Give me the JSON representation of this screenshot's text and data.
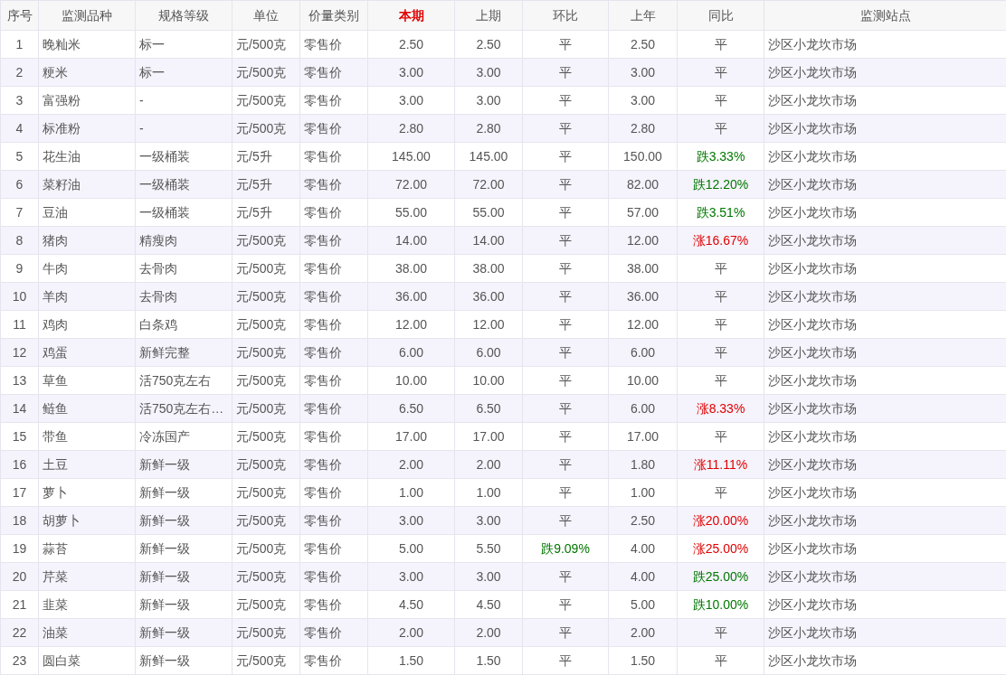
{
  "table": {
    "columns": [
      {
        "label": "序号",
        "highlight": false
      },
      {
        "label": "监测品种",
        "highlight": false
      },
      {
        "label": "规格等级",
        "highlight": false
      },
      {
        "label": "单位",
        "highlight": false
      },
      {
        "label": "价量类别",
        "highlight": false
      },
      {
        "label": "本期",
        "highlight": true
      },
      {
        "label": "上期",
        "highlight": false
      },
      {
        "label": "环比",
        "highlight": false
      },
      {
        "label": "上年",
        "highlight": false
      },
      {
        "label": "同比",
        "highlight": false
      },
      {
        "label": "监测站点",
        "highlight": false
      }
    ],
    "rows": [
      {
        "no": "1",
        "item": "晚籼米",
        "grade": "标一",
        "unit": "元/500克",
        "price_type": "零售价",
        "current": "2.50",
        "previous": "2.50",
        "mom": {
          "text": "平",
          "kind": "flat"
        },
        "last_year": "2.50",
        "yoy": {
          "text": "平",
          "kind": "flat"
        },
        "station": "沙区小龙坎市场"
      },
      {
        "no": "2",
        "item": "粳米",
        "grade": "标一",
        "unit": "元/500克",
        "price_type": "零售价",
        "current": "3.00",
        "previous": "3.00",
        "mom": {
          "text": "平",
          "kind": "flat"
        },
        "last_year": "3.00",
        "yoy": {
          "text": "平",
          "kind": "flat"
        },
        "station": "沙区小龙坎市场"
      },
      {
        "no": "3",
        "item": "富强粉",
        "grade": "-",
        "unit": "元/500克",
        "price_type": "零售价",
        "current": "3.00",
        "previous": "3.00",
        "mom": {
          "text": "平",
          "kind": "flat"
        },
        "last_year": "3.00",
        "yoy": {
          "text": "平",
          "kind": "flat"
        },
        "station": "沙区小龙坎市场"
      },
      {
        "no": "4",
        "item": "标准粉",
        "grade": "-",
        "unit": "元/500克",
        "price_type": "零售价",
        "current": "2.80",
        "previous": "2.80",
        "mom": {
          "text": "平",
          "kind": "flat"
        },
        "last_year": "2.80",
        "yoy": {
          "text": "平",
          "kind": "flat"
        },
        "station": "沙区小龙坎市场"
      },
      {
        "no": "5",
        "item": "花生油",
        "grade": "一级桶装",
        "unit": "元/5升",
        "price_type": "零售价",
        "current": "145.00",
        "previous": "145.00",
        "mom": {
          "text": "平",
          "kind": "flat"
        },
        "last_year": "150.00",
        "yoy": {
          "text": "跌3.33%",
          "kind": "down"
        },
        "station": "沙区小龙坎市场"
      },
      {
        "no": "6",
        "item": "菜籽油",
        "grade": "一级桶装",
        "unit": "元/5升",
        "price_type": "零售价",
        "current": "72.00",
        "previous": "72.00",
        "mom": {
          "text": "平",
          "kind": "flat"
        },
        "last_year": "82.00",
        "yoy": {
          "text": "跌12.20%",
          "kind": "down"
        },
        "station": "沙区小龙坎市场"
      },
      {
        "no": "7",
        "item": "豆油",
        "grade": "一级桶装",
        "unit": "元/5升",
        "price_type": "零售价",
        "current": "55.00",
        "previous": "55.00",
        "mom": {
          "text": "平",
          "kind": "flat"
        },
        "last_year": "57.00",
        "yoy": {
          "text": "跌3.51%",
          "kind": "down"
        },
        "station": "沙区小龙坎市场"
      },
      {
        "no": "8",
        "item": "猪肉",
        "grade": "精瘦肉",
        "unit": "元/500克",
        "price_type": "零售价",
        "current": "14.00",
        "previous": "14.00",
        "mom": {
          "text": "平",
          "kind": "flat"
        },
        "last_year": "12.00",
        "yoy": {
          "text": "涨16.67%",
          "kind": "up"
        },
        "station": "沙区小龙坎市场"
      },
      {
        "no": "9",
        "item": "牛肉",
        "grade": "去骨肉",
        "unit": "元/500克",
        "price_type": "零售价",
        "current": "38.00",
        "previous": "38.00",
        "mom": {
          "text": "平",
          "kind": "flat"
        },
        "last_year": "38.00",
        "yoy": {
          "text": "平",
          "kind": "flat"
        },
        "station": "沙区小龙坎市场"
      },
      {
        "no": "10",
        "item": "羊肉",
        "grade": "去骨肉",
        "unit": "元/500克",
        "price_type": "零售价",
        "current": "36.00",
        "previous": "36.00",
        "mom": {
          "text": "平",
          "kind": "flat"
        },
        "last_year": "36.00",
        "yoy": {
          "text": "平",
          "kind": "flat"
        },
        "station": "沙区小龙坎市场"
      },
      {
        "no": "11",
        "item": "鸡肉",
        "grade": "白条鸡",
        "unit": "元/500克",
        "price_type": "零售价",
        "current": "12.00",
        "previous": "12.00",
        "mom": {
          "text": "平",
          "kind": "flat"
        },
        "last_year": "12.00",
        "yoy": {
          "text": "平",
          "kind": "flat"
        },
        "station": "沙区小龙坎市场"
      },
      {
        "no": "12",
        "item": "鸡蛋",
        "grade": "新鲜完整",
        "unit": "元/500克",
        "price_type": "零售价",
        "current": "6.00",
        "previous": "6.00",
        "mom": {
          "text": "平",
          "kind": "flat"
        },
        "last_year": "6.00",
        "yoy": {
          "text": "平",
          "kind": "flat"
        },
        "station": "沙区小龙坎市场"
      },
      {
        "no": "13",
        "item": "草鱼",
        "grade": "活750克左右",
        "unit": "元/500克",
        "price_type": "零售价",
        "current": "10.00",
        "previous": "10.00",
        "mom": {
          "text": "平",
          "kind": "flat"
        },
        "last_year": "10.00",
        "yoy": {
          "text": "平",
          "kind": "flat"
        },
        "station": "沙区小龙坎市场"
      },
      {
        "no": "14",
        "item": "鲢鱼",
        "grade": "活750克左右…",
        "unit": "元/500克",
        "price_type": "零售价",
        "current": "6.50",
        "previous": "6.50",
        "mom": {
          "text": "平",
          "kind": "flat"
        },
        "last_year": "6.00",
        "yoy": {
          "text": "涨8.33%",
          "kind": "up"
        },
        "station": "沙区小龙坎市场"
      },
      {
        "no": "15",
        "item": "带鱼",
        "grade": "冷冻国产",
        "unit": "元/500克",
        "price_type": "零售价",
        "current": "17.00",
        "previous": "17.00",
        "mom": {
          "text": "平",
          "kind": "flat"
        },
        "last_year": "17.00",
        "yoy": {
          "text": "平",
          "kind": "flat"
        },
        "station": "沙区小龙坎市场"
      },
      {
        "no": "16",
        "item": "土豆",
        "grade": "新鲜一级",
        "unit": "元/500克",
        "price_type": "零售价",
        "current": "2.00",
        "previous": "2.00",
        "mom": {
          "text": "平",
          "kind": "flat"
        },
        "last_year": "1.80",
        "yoy": {
          "text": "涨11.11%",
          "kind": "up"
        },
        "station": "沙区小龙坎市场"
      },
      {
        "no": "17",
        "item": "萝卜",
        "grade": "新鲜一级",
        "unit": "元/500克",
        "price_type": "零售价",
        "current": "1.00",
        "previous": "1.00",
        "mom": {
          "text": "平",
          "kind": "flat"
        },
        "last_year": "1.00",
        "yoy": {
          "text": "平",
          "kind": "flat"
        },
        "station": "沙区小龙坎市场"
      },
      {
        "no": "18",
        "item": "胡萝卜",
        "grade": "新鲜一级",
        "unit": "元/500克",
        "price_type": "零售价",
        "current": "3.00",
        "previous": "3.00",
        "mom": {
          "text": "平",
          "kind": "flat"
        },
        "last_year": "2.50",
        "yoy": {
          "text": "涨20.00%",
          "kind": "up"
        },
        "station": "沙区小龙坎市场"
      },
      {
        "no": "19",
        "item": "蒜苔",
        "grade": "新鲜一级",
        "unit": "元/500克",
        "price_type": "零售价",
        "current": "5.00",
        "previous": "5.50",
        "mom": {
          "text": "跌9.09%",
          "kind": "down"
        },
        "last_year": "4.00",
        "yoy": {
          "text": "涨25.00%",
          "kind": "up"
        },
        "station": "沙区小龙坎市场"
      },
      {
        "no": "20",
        "item": "芹菜",
        "grade": "新鲜一级",
        "unit": "元/500克",
        "price_type": "零售价",
        "current": "3.00",
        "previous": "3.00",
        "mom": {
          "text": "平",
          "kind": "flat"
        },
        "last_year": "4.00",
        "yoy": {
          "text": "跌25.00%",
          "kind": "down"
        },
        "station": "沙区小龙坎市场"
      },
      {
        "no": "21",
        "item": "韭菜",
        "grade": "新鲜一级",
        "unit": "元/500克",
        "price_type": "零售价",
        "current": "4.50",
        "previous": "4.50",
        "mom": {
          "text": "平",
          "kind": "flat"
        },
        "last_year": "5.00",
        "yoy": {
          "text": "跌10.00%",
          "kind": "down"
        },
        "station": "沙区小龙坎市场"
      },
      {
        "no": "22",
        "item": "油菜",
        "grade": "新鲜一级",
        "unit": "元/500克",
        "price_type": "零售价",
        "current": "2.00",
        "previous": "2.00",
        "mom": {
          "text": "平",
          "kind": "flat"
        },
        "last_year": "2.00",
        "yoy": {
          "text": "平",
          "kind": "flat"
        },
        "station": "沙区小龙坎市场"
      },
      {
        "no": "23",
        "item": "圆白菜",
        "grade": "新鲜一级",
        "unit": "元/500克",
        "price_type": "零售价",
        "current": "1.50",
        "previous": "1.50",
        "mom": {
          "text": "平",
          "kind": "flat"
        },
        "last_year": "1.50",
        "yoy": {
          "text": "平",
          "kind": "flat"
        },
        "station": "沙区小龙坎市场"
      }
    ]
  }
}
